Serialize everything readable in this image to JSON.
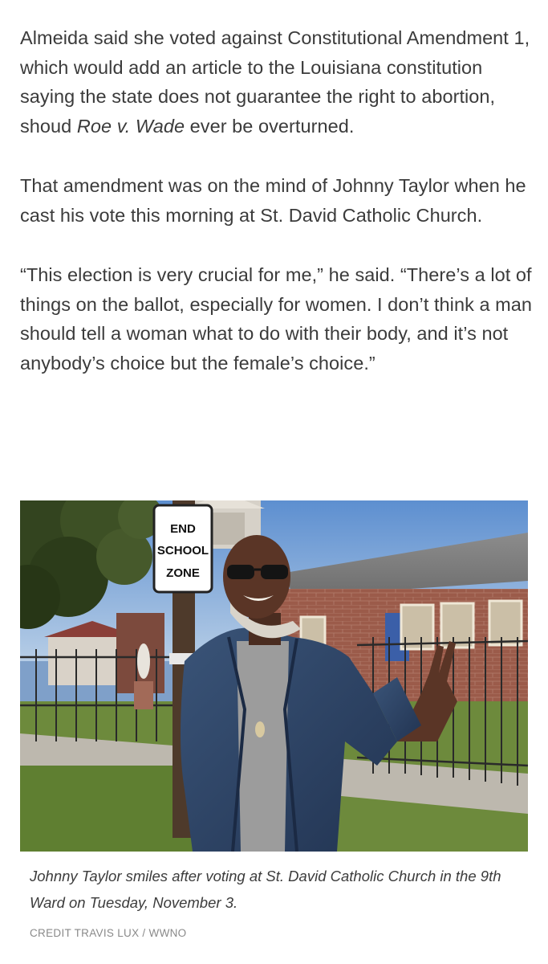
{
  "article": {
    "paragraph_1": {
      "before_italic": "Almeida said she voted against Constitutional Amendment 1, which would add an article to the Louisiana constitution saying the state does not guarantee the right to abortion, shoud ",
      "italic": "Roe v. Wade",
      "after_italic": " ever be overturned."
    },
    "paragraph_2": "That amendment was on the mind of Johnny Taylor when he cast his vote this morning at St. David Catholic Church.",
    "paragraph_3": "“This election is very crucial for me,” he said. “There’s a lot of things on the ballot, especially for women. I don’t think a man should tell a woman what to do with their body, and it’s not anybody’s choice but the female’s choice.”"
  },
  "photo": {
    "sign_lines": [
      "END",
      "SCHOOL",
      "ZONE"
    ],
    "colors": {
      "sky": "#7ea3cf",
      "brick": "#9a5a48",
      "jacket": "#2f4465",
      "grass": "#6d8a3c"
    }
  },
  "caption": {
    "text": "Johnny Taylor smiles after voting at St. David Catholic Church in the 9th Ward on Tuesday, November 3.",
    "credit": "CREDIT TRAVIS LUX / WWNO"
  }
}
